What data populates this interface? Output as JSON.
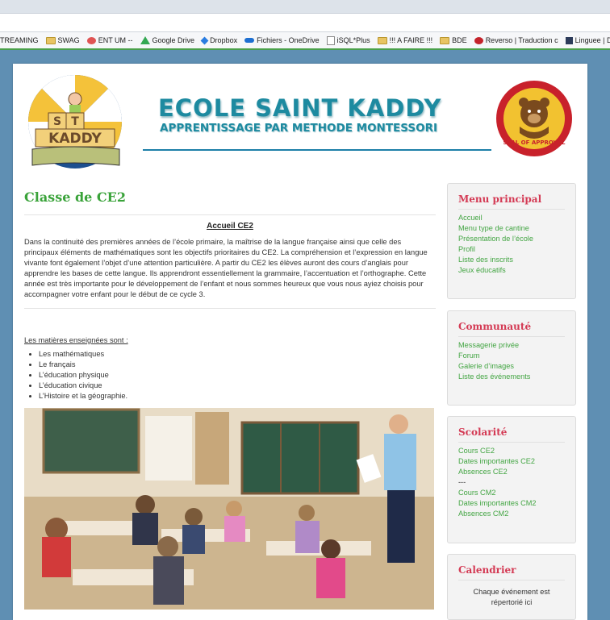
{
  "bookmarks": [
    {
      "label": "TREAMING",
      "icon": "folder-icon"
    },
    {
      "label": "SWAG",
      "icon": "folder-icon"
    },
    {
      "label": "ENT UM --",
      "icon": "um-icon"
    },
    {
      "label": "Google Drive",
      "icon": "drive-icon"
    },
    {
      "label": "Dropbox",
      "icon": "dropbox-icon"
    },
    {
      "label": "Fichiers - OneDrive",
      "icon": "onedrive-icon"
    },
    {
      "label": "iSQL*Plus",
      "icon": "isql-icon"
    },
    {
      "label": "!!! A FAIRE !!!",
      "icon": "folder-icon"
    },
    {
      "label": "BDE",
      "icon": "folder-icon"
    },
    {
      "label": "Reverso | Traduction c",
      "icon": "reverso-icon"
    },
    {
      "label": "Linguee | Diction",
      "icon": "linguee-icon"
    }
  ],
  "header": {
    "title": "ECOLE SAINT KADDY",
    "subtitle": "APPRENTISSAGE PAR METHODE MONTESSORI",
    "logo_text": [
      "S",
      "T",
      "KADDY"
    ],
    "seal_text": "SEAL OF APPROVAL"
  },
  "main": {
    "page_title": "Classe de CE2",
    "section_title": "Accueil CE2",
    "paragraph": "Dans la continuité des premières années de l’école primaire, la maîtrise de la langue française ainsi que celle des principaux éléments de mathématiques sont les objectifs prioritaires du CE2. La compréhension et l’expression en langue vivante font également l’objet d’une attention particulière. A partir du CE2 les élèves auront des cours d’anglais pour apprendre les bases de cette langue. Ils apprendront essentiellement la grammaire, l’accentuation et l’orthographe. Cette année est très importante pour le développement de l’enfant et nous sommes heureux que vous nous ayiez choisis pour accompagner votre enfant pour le début de ce cycle 3.",
    "subjects_title": "Les matières enseignées sont :",
    "subjects": [
      "Les mathématiques",
      "Le français",
      "L’éducation physique",
      "L’éducation civique",
      "L’Histoire et la géographie."
    ]
  },
  "sidebar": {
    "menu": {
      "title": "Menu principal",
      "items": [
        "Accueil",
        "Menu type de cantine",
        "Présentation de l’école",
        "Profil",
        "Liste des inscrits",
        "Jeux éducatifs"
      ]
    },
    "community": {
      "title": "Communauté",
      "items": [
        "Messagerie privée",
        "Forum",
        "Galerie d’images",
        "Liste des événements"
      ]
    },
    "school": {
      "title": "Scolarité",
      "items": [
        "Cours CE2",
        "Dates importantes CE2",
        "Absences CE2",
        "---",
        "Cours CM2",
        "Dates importantes CM2",
        "Absences CM2"
      ]
    },
    "calendar": {
      "title": "Calendrier",
      "text_line1": "Chaque événement est",
      "text_line2": "répertorié ici"
    }
  }
}
